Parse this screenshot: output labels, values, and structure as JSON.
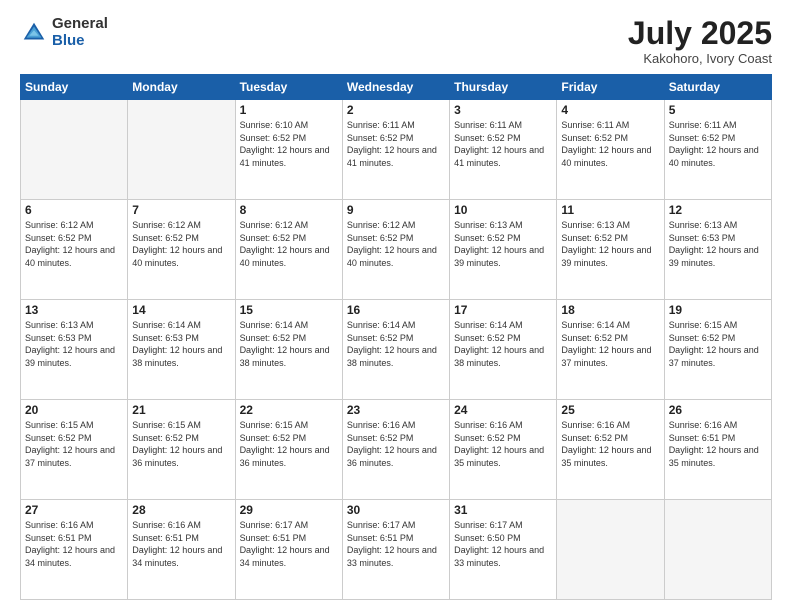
{
  "logo": {
    "general": "General",
    "blue": "Blue"
  },
  "header": {
    "month": "July 2025",
    "location": "Kakohoro, Ivory Coast"
  },
  "weekdays": [
    "Sunday",
    "Monday",
    "Tuesday",
    "Wednesday",
    "Thursday",
    "Friday",
    "Saturday"
  ],
  "weeks": [
    [
      {
        "day": "",
        "info": ""
      },
      {
        "day": "",
        "info": ""
      },
      {
        "day": "1",
        "info": "Sunrise: 6:10 AM\nSunset: 6:52 PM\nDaylight: 12 hours and 41 minutes."
      },
      {
        "day": "2",
        "info": "Sunrise: 6:11 AM\nSunset: 6:52 PM\nDaylight: 12 hours and 41 minutes."
      },
      {
        "day": "3",
        "info": "Sunrise: 6:11 AM\nSunset: 6:52 PM\nDaylight: 12 hours and 41 minutes."
      },
      {
        "day": "4",
        "info": "Sunrise: 6:11 AM\nSunset: 6:52 PM\nDaylight: 12 hours and 40 minutes."
      },
      {
        "day": "5",
        "info": "Sunrise: 6:11 AM\nSunset: 6:52 PM\nDaylight: 12 hours and 40 minutes."
      }
    ],
    [
      {
        "day": "6",
        "info": "Sunrise: 6:12 AM\nSunset: 6:52 PM\nDaylight: 12 hours and 40 minutes."
      },
      {
        "day": "7",
        "info": "Sunrise: 6:12 AM\nSunset: 6:52 PM\nDaylight: 12 hours and 40 minutes."
      },
      {
        "day": "8",
        "info": "Sunrise: 6:12 AM\nSunset: 6:52 PM\nDaylight: 12 hours and 40 minutes."
      },
      {
        "day": "9",
        "info": "Sunrise: 6:12 AM\nSunset: 6:52 PM\nDaylight: 12 hours and 40 minutes."
      },
      {
        "day": "10",
        "info": "Sunrise: 6:13 AM\nSunset: 6:52 PM\nDaylight: 12 hours and 39 minutes."
      },
      {
        "day": "11",
        "info": "Sunrise: 6:13 AM\nSunset: 6:52 PM\nDaylight: 12 hours and 39 minutes."
      },
      {
        "day": "12",
        "info": "Sunrise: 6:13 AM\nSunset: 6:53 PM\nDaylight: 12 hours and 39 minutes."
      }
    ],
    [
      {
        "day": "13",
        "info": "Sunrise: 6:13 AM\nSunset: 6:53 PM\nDaylight: 12 hours and 39 minutes."
      },
      {
        "day": "14",
        "info": "Sunrise: 6:14 AM\nSunset: 6:53 PM\nDaylight: 12 hours and 38 minutes."
      },
      {
        "day": "15",
        "info": "Sunrise: 6:14 AM\nSunset: 6:52 PM\nDaylight: 12 hours and 38 minutes."
      },
      {
        "day": "16",
        "info": "Sunrise: 6:14 AM\nSunset: 6:52 PM\nDaylight: 12 hours and 38 minutes."
      },
      {
        "day": "17",
        "info": "Sunrise: 6:14 AM\nSunset: 6:52 PM\nDaylight: 12 hours and 38 minutes."
      },
      {
        "day": "18",
        "info": "Sunrise: 6:14 AM\nSunset: 6:52 PM\nDaylight: 12 hours and 37 minutes."
      },
      {
        "day": "19",
        "info": "Sunrise: 6:15 AM\nSunset: 6:52 PM\nDaylight: 12 hours and 37 minutes."
      }
    ],
    [
      {
        "day": "20",
        "info": "Sunrise: 6:15 AM\nSunset: 6:52 PM\nDaylight: 12 hours and 37 minutes."
      },
      {
        "day": "21",
        "info": "Sunrise: 6:15 AM\nSunset: 6:52 PM\nDaylight: 12 hours and 36 minutes."
      },
      {
        "day": "22",
        "info": "Sunrise: 6:15 AM\nSunset: 6:52 PM\nDaylight: 12 hours and 36 minutes."
      },
      {
        "day": "23",
        "info": "Sunrise: 6:16 AM\nSunset: 6:52 PM\nDaylight: 12 hours and 36 minutes."
      },
      {
        "day": "24",
        "info": "Sunrise: 6:16 AM\nSunset: 6:52 PM\nDaylight: 12 hours and 35 minutes."
      },
      {
        "day": "25",
        "info": "Sunrise: 6:16 AM\nSunset: 6:52 PM\nDaylight: 12 hours and 35 minutes."
      },
      {
        "day": "26",
        "info": "Sunrise: 6:16 AM\nSunset: 6:51 PM\nDaylight: 12 hours and 35 minutes."
      }
    ],
    [
      {
        "day": "27",
        "info": "Sunrise: 6:16 AM\nSunset: 6:51 PM\nDaylight: 12 hours and 34 minutes."
      },
      {
        "day": "28",
        "info": "Sunrise: 6:16 AM\nSunset: 6:51 PM\nDaylight: 12 hours and 34 minutes."
      },
      {
        "day": "29",
        "info": "Sunrise: 6:17 AM\nSunset: 6:51 PM\nDaylight: 12 hours and 34 minutes."
      },
      {
        "day": "30",
        "info": "Sunrise: 6:17 AM\nSunset: 6:51 PM\nDaylight: 12 hours and 33 minutes."
      },
      {
        "day": "31",
        "info": "Sunrise: 6:17 AM\nSunset: 6:50 PM\nDaylight: 12 hours and 33 minutes."
      },
      {
        "day": "",
        "info": ""
      },
      {
        "day": "",
        "info": ""
      }
    ]
  ]
}
